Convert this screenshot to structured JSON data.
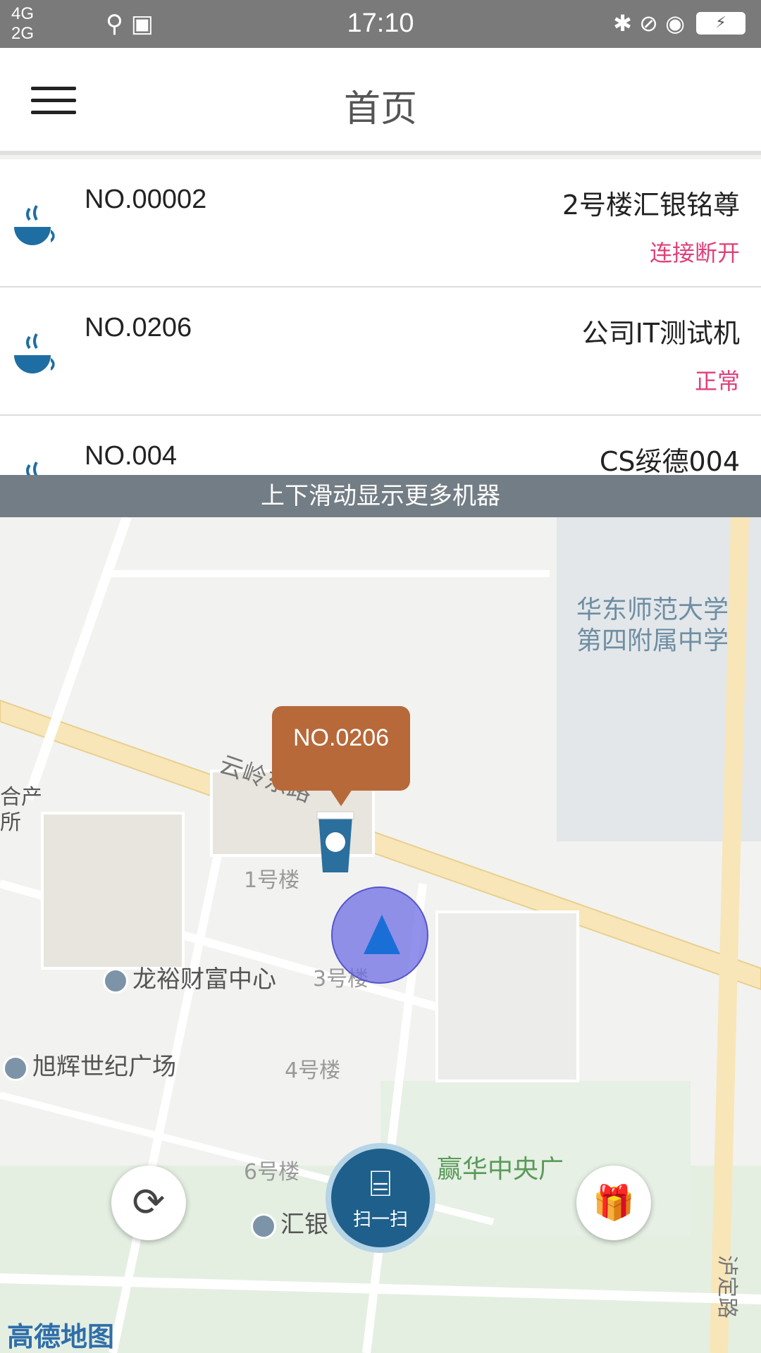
{
  "status_bar": {
    "network_top": "4G",
    "network_bottom": "2G",
    "time": "17:10",
    "usb": "⚲ ▣",
    "bt_mute_wifi": "✱ ⊘ ◉",
    "battery": "⚡"
  },
  "header": {
    "title": "首页"
  },
  "machines": [
    {
      "code": "NO.00002",
      "name": "2号楼汇银铭尊",
      "status": "连接断开"
    },
    {
      "code": "NO.0206",
      "name": "公司IT测试机",
      "status": "正常"
    },
    {
      "code": "NO.004",
      "name": "CS绥德004",
      "status": ""
    }
  ],
  "hint": "上下滑动显示更多机器",
  "map": {
    "labels": {
      "school": "华东师范大学\n第四附属中学",
      "road1": "云岭东路",
      "b1": "1号楼",
      "b3": "3号楼",
      "b4": "4号楼",
      "b6": "6号楼",
      "longyu": "龙裕财富中心",
      "xuhui": "旭辉世纪广场",
      "huiyin": "汇银",
      "yinghua": "赢华中央广",
      "hechan": "合产\n所",
      "road2": "泸定路"
    },
    "callout": "NO.0206",
    "provider": "高德地图"
  },
  "buttons": {
    "refresh_icon": "⟳",
    "scan_icon": "⌸",
    "scan_label": "扫一扫",
    "gift_icon": "🎁"
  },
  "colors": {
    "status_bar": "#7a7a7a",
    "accent_status": "#e0407a",
    "hint_bar": "#737d85",
    "scan_button": "#1f5f8b",
    "callout": "#b7693a"
  }
}
